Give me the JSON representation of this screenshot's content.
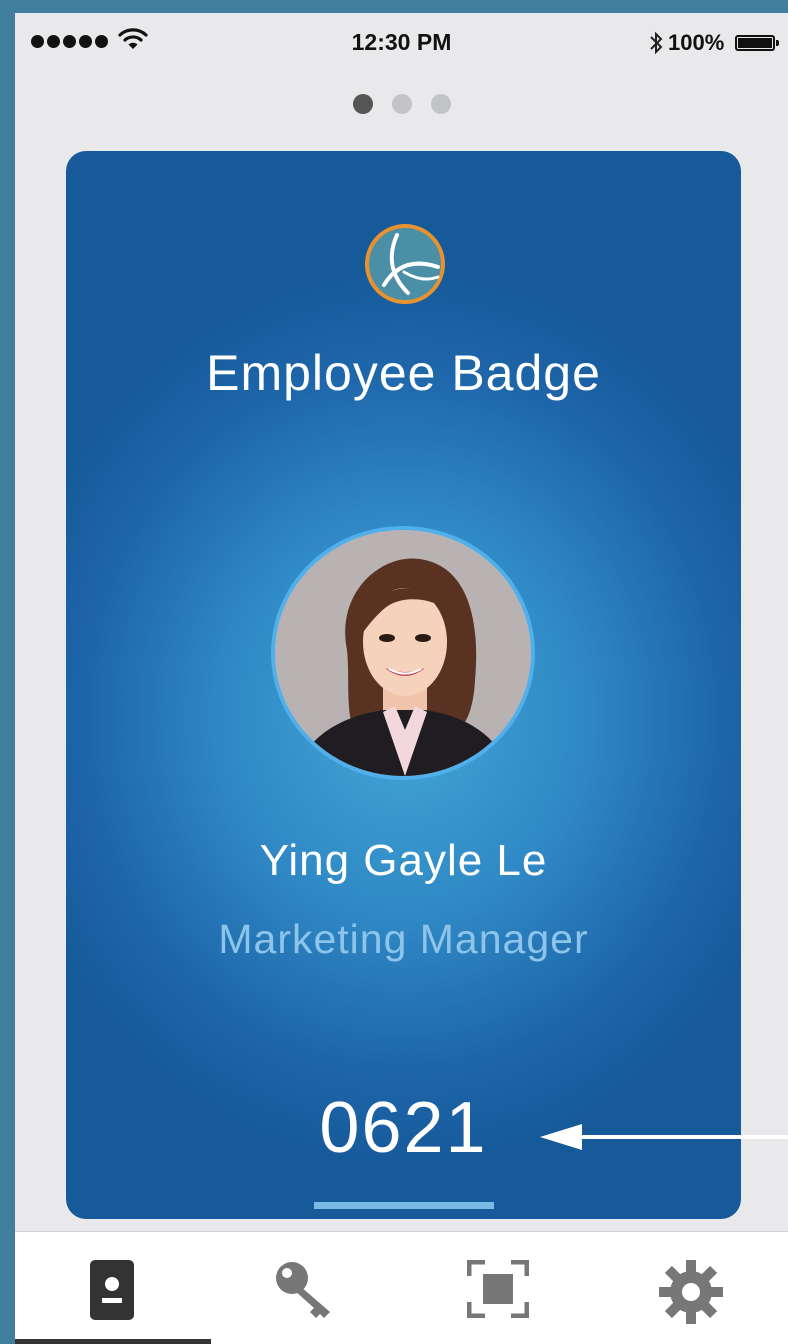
{
  "status_bar": {
    "time": "12:30 PM",
    "battery_percent": "100%",
    "signal_bars": 5,
    "icons": [
      "signal-dots",
      "wifi-icon",
      "bluetooth-icon",
      "battery-icon"
    ]
  },
  "pager": {
    "total": 3,
    "active_index": 0
  },
  "badge": {
    "title": "Employee Badge",
    "name": "Ying Gayle Le",
    "role": "Marketing Manager",
    "number": "0621",
    "logo": "company-logo"
  },
  "colors": {
    "card_dark": "#165a9a",
    "card_light": "#44a6d6",
    "avatar_ring": "#4fb0ec",
    "role_text": "#8dc4ea",
    "logo_ring": "#e8912f",
    "logo_fill": "#4a8fa6"
  },
  "tab_bar": {
    "tabs": [
      {
        "icon": "badge-icon",
        "active": true
      },
      {
        "icon": "key-icon",
        "active": false
      },
      {
        "icon": "scan-icon",
        "active": false
      },
      {
        "icon": "gear-icon",
        "active": false
      }
    ]
  }
}
